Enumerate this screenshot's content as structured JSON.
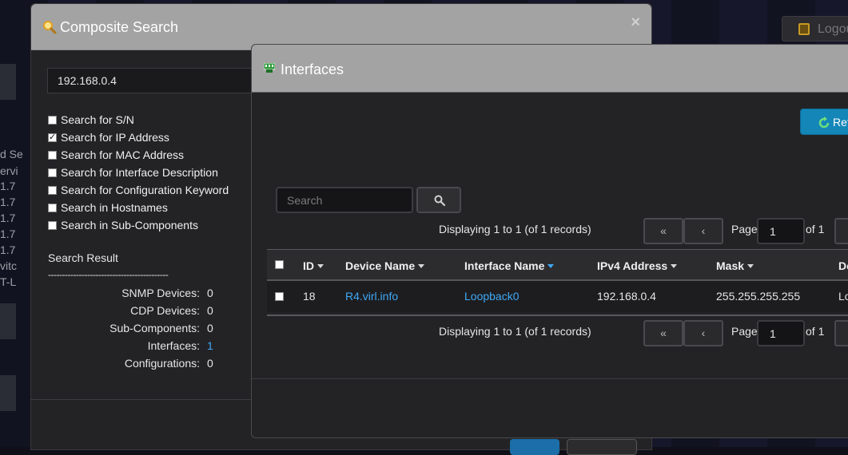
{
  "background": {
    "logout_label": "Logou",
    "fragments": [
      "d Se",
      "ervi",
      "1.7",
      "1.7",
      "1.7",
      "1.7",
      "1.7",
      "vitc",
      "T-L"
    ]
  },
  "composite_search": {
    "title": "Composite Search",
    "close_icon": "×",
    "search_value": "192.168.0.4",
    "options": [
      {
        "label": "Search for S/N",
        "checked": false
      },
      {
        "label": "Search for IP Address",
        "checked": true
      },
      {
        "label": "Search for MAC Address",
        "checked": false
      },
      {
        "label": "Search for Interface Description",
        "checked": false
      },
      {
        "label": "Search for Configuration Keyword",
        "checked": false
      },
      {
        "label": "Search in Hostnames",
        "checked": false
      },
      {
        "label": "Search in Sub-Components",
        "checked": false
      }
    ],
    "result_title": "Search Result",
    "separator": "-------------------------------------------",
    "results": [
      {
        "label": "SNMP Devices:",
        "value": "0"
      },
      {
        "label": "CDP Devices:",
        "value": "0"
      },
      {
        "label": "Sub-Components:",
        "value": "0"
      },
      {
        "label": "Interfaces:",
        "value": "1"
      },
      {
        "label": "Configurations:",
        "value": "0"
      }
    ]
  },
  "interfaces": {
    "title": "Interfaces",
    "refresh_label": "Ref",
    "search_placeholder": "Search",
    "display_text": "Displaying 1 to 1 (of 1 records)",
    "pager": {
      "first": "«",
      "prev": "‹",
      "page_label": "Page",
      "page_value": "1",
      "of_label": "of 1"
    },
    "columns": [
      "ID",
      "Device Name",
      "Interface Name",
      "IPv4 Address",
      "Mask",
      "De"
    ],
    "rows": [
      {
        "id": "18",
        "device": "R4.virl.info",
        "interface": "Loopback0",
        "ipv4": "192.168.0.4",
        "mask": "255.255.255.255",
        "desc": "Lo"
      }
    ]
  },
  "colors": {
    "link": "#3fa9f5",
    "refresh_button": "#1486b8",
    "header": "#a3a3a3",
    "panel": "#232326"
  }
}
